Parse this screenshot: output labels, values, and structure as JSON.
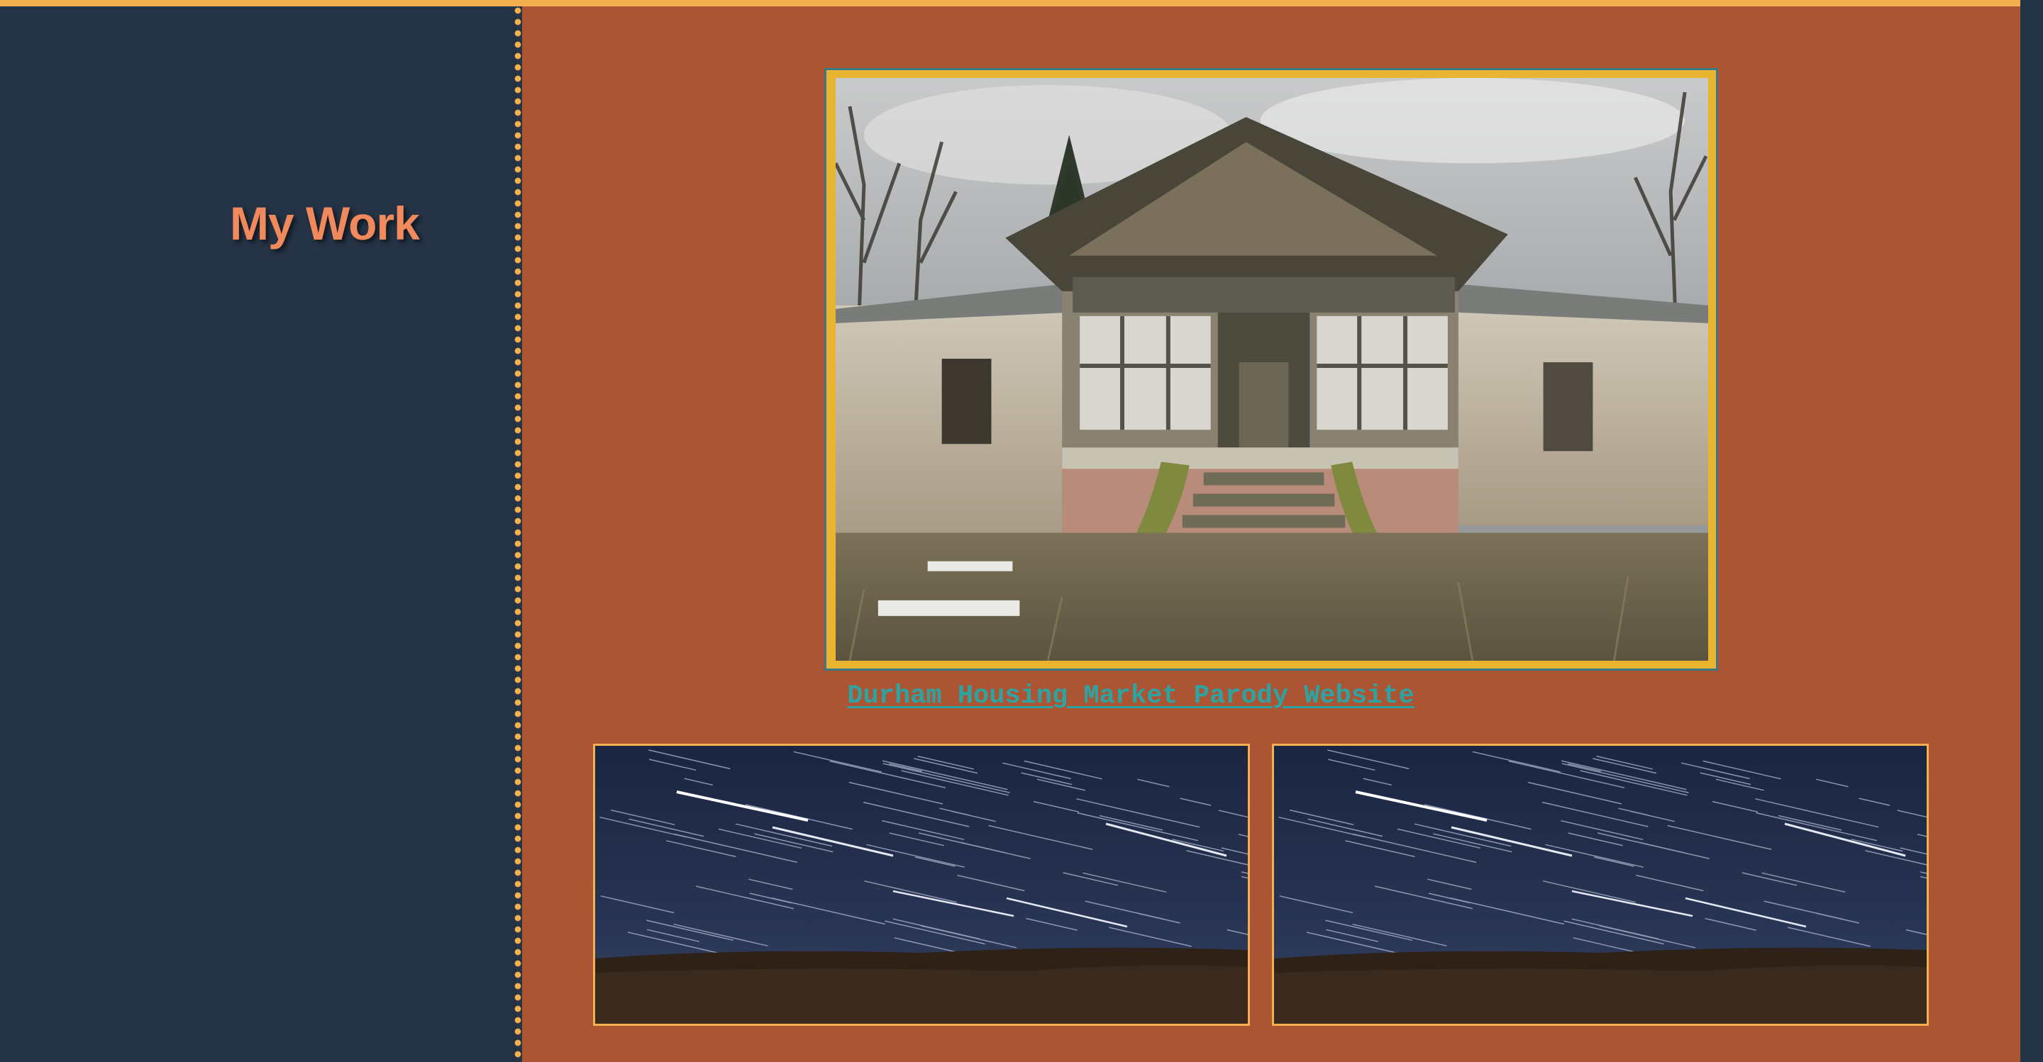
{
  "sidebar": {
    "title": "My Work"
  },
  "main": {
    "featured": {
      "image_description": "abandoned house",
      "link_text": "Durham Housing Market Parody Website"
    },
    "thumbnails": [
      {
        "image_description": "star trails night sky"
      },
      {
        "image_description": "star trails night sky"
      }
    ]
  },
  "colors": {
    "sidebar_bg": "#243345",
    "main_bg": "#ab5535",
    "accent_gold": "#f4b04f",
    "title_color": "#f08a5d",
    "link_color": "#2ea4a2"
  }
}
